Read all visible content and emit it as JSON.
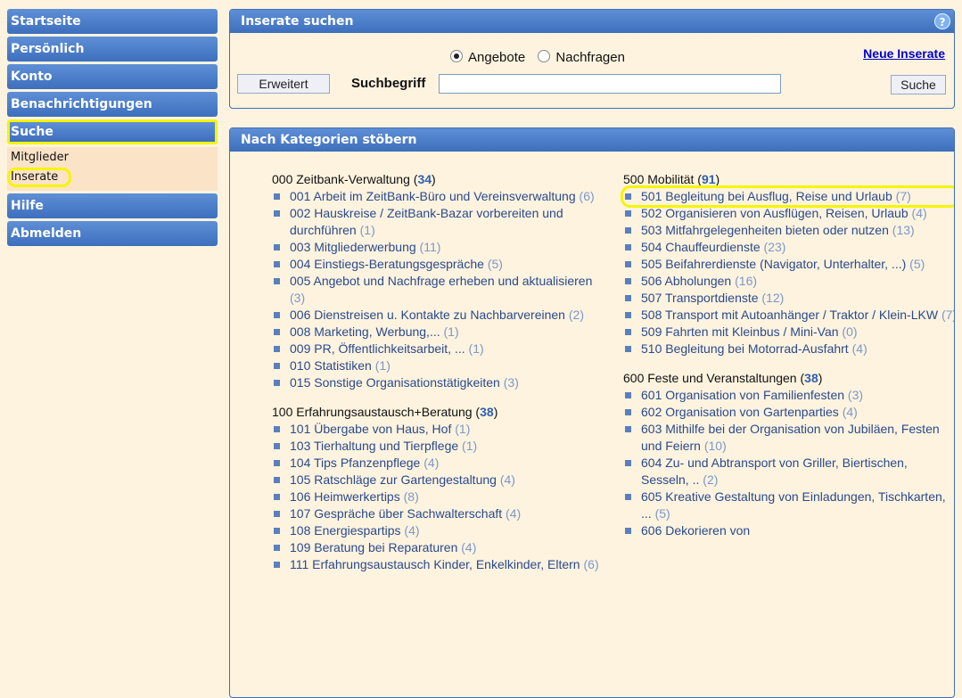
{
  "sidebar": {
    "items": [
      {
        "label": "Startseite"
      },
      {
        "label": "Persönlich"
      },
      {
        "label": "Konto"
      },
      {
        "label": "Benachrichtigungen"
      },
      {
        "label": "Suche"
      },
      {
        "label": "Hilfe"
      },
      {
        "label": "Abmelden"
      }
    ],
    "sub": [
      {
        "label": "Mitglieder"
      },
      {
        "label": "Inserate"
      }
    ]
  },
  "search": {
    "title": "Inserate suchen",
    "help_icon": "?",
    "radio_offers": "Angebote",
    "radio_requests": "Nachfragen",
    "new_link": "Neue Inserate",
    "advanced_button": "Erweitert",
    "term_label": "Suchbegriff",
    "term_value": "",
    "search_button": "Suche"
  },
  "categories": {
    "title": "Nach Kategorien stöbern",
    "left": [
      {
        "name": "000 Zeitbank-Verwaltung",
        "count": "34",
        "items": [
          {
            "label": "001 Arbeit im ZeitBank-Büro und Vereinsverwaltung",
            "count": "6"
          },
          {
            "label": "002 Hauskreise / ZeitBank-Bazar vorbereiten und durchführen",
            "count": "1"
          },
          {
            "label": "003 Mitgliederwerbung",
            "count": "11"
          },
          {
            "label": "004 Einstiegs-Beratungsgespräche",
            "count": "5"
          },
          {
            "label": "005 Angebot und Nachfrage erheben und aktualisieren",
            "count": "3"
          },
          {
            "label": "006 Dienstreisen u. Kontakte zu Nachbarvereinen",
            "count": "2"
          },
          {
            "label": "008 Marketing, Werbung,...",
            "count": "1"
          },
          {
            "label": "009 PR, Öffentlichkeitsarbeit, ...",
            "count": "1"
          },
          {
            "label": "010 Statistiken",
            "count": "1"
          },
          {
            "label": "015 Sonstige Organisationstätigkeiten",
            "count": "3"
          }
        ]
      },
      {
        "name": "100 Erfahrungsaustausch+Beratung",
        "count": "38",
        "items": [
          {
            "label": "101 Übergabe von Haus, Hof",
            "count": "1"
          },
          {
            "label": "103 Tierhaltung und Tierpflege",
            "count": "1"
          },
          {
            "label": "104 Tips Pfanzenpflege",
            "count": "4"
          },
          {
            "label": "105 Ratschläge zur Gartengestaltung",
            "count": "4"
          },
          {
            "label": "106 Heimwerkertips",
            "count": "8"
          },
          {
            "label": "107 Gespräche über Sachwalterschaft",
            "count": "4"
          },
          {
            "label": "108 Energiespartips",
            "count": "4"
          },
          {
            "label": "109 Beratung bei Reparaturen",
            "count": "4"
          },
          {
            "label": "111 Erfahrungsaustausch Kinder, Enkelkinder, Eltern",
            "count": "6"
          }
        ]
      }
    ],
    "right": [
      {
        "name": "500 Mobilität",
        "count": "91",
        "items": [
          {
            "label": "501 Begleitung bei Ausflug, Reise und Urlaub",
            "count": "7"
          },
          {
            "label": "502 Organisieren von Ausflügen, Reisen, Urlaub",
            "count": "4"
          },
          {
            "label": "503 Mitfahrgelegenheiten bieten oder nutzen",
            "count": "13"
          },
          {
            "label": "504 Chauffeurdienste",
            "count": "23"
          },
          {
            "label": "505 Beifahrerdienste (Navigator, Unterhalter, ...)",
            "count": "5"
          },
          {
            "label": "506 Abholungen",
            "count": "16"
          },
          {
            "label": "507 Transportdienste",
            "count": "12"
          },
          {
            "label": "508 Transport mit Autoanhänger / Traktor / Klein-LKW",
            "count": "7"
          },
          {
            "label": "509 Fahrten mit Kleinbus / Mini-Van",
            "count": "0"
          },
          {
            "label": "510 Begleitung bei Motorrad-Ausfahrt",
            "count": "4"
          }
        ]
      },
      {
        "name": "600 Feste und Veranstaltungen",
        "count": "38",
        "items": [
          {
            "label": "601 Organisation von Familienfesten",
            "count": "3"
          },
          {
            "label": "602 Organisation von Gartenparties",
            "count": "4"
          },
          {
            "label": "603 Mithilfe bei der Organisation von Jubiläen, Festen und Feiern",
            "count": "10"
          },
          {
            "label": "604 Zu- und Abtransport von Griller, Biertischen, Sesseln, ..",
            "count": "2"
          },
          {
            "label": "605 Kreative Gestaltung von Einladungen, Tischkarten, ...",
            "count": "5"
          },
          {
            "label": "606 Dekorieren von",
            "count": ""
          }
        ]
      }
    ]
  }
}
